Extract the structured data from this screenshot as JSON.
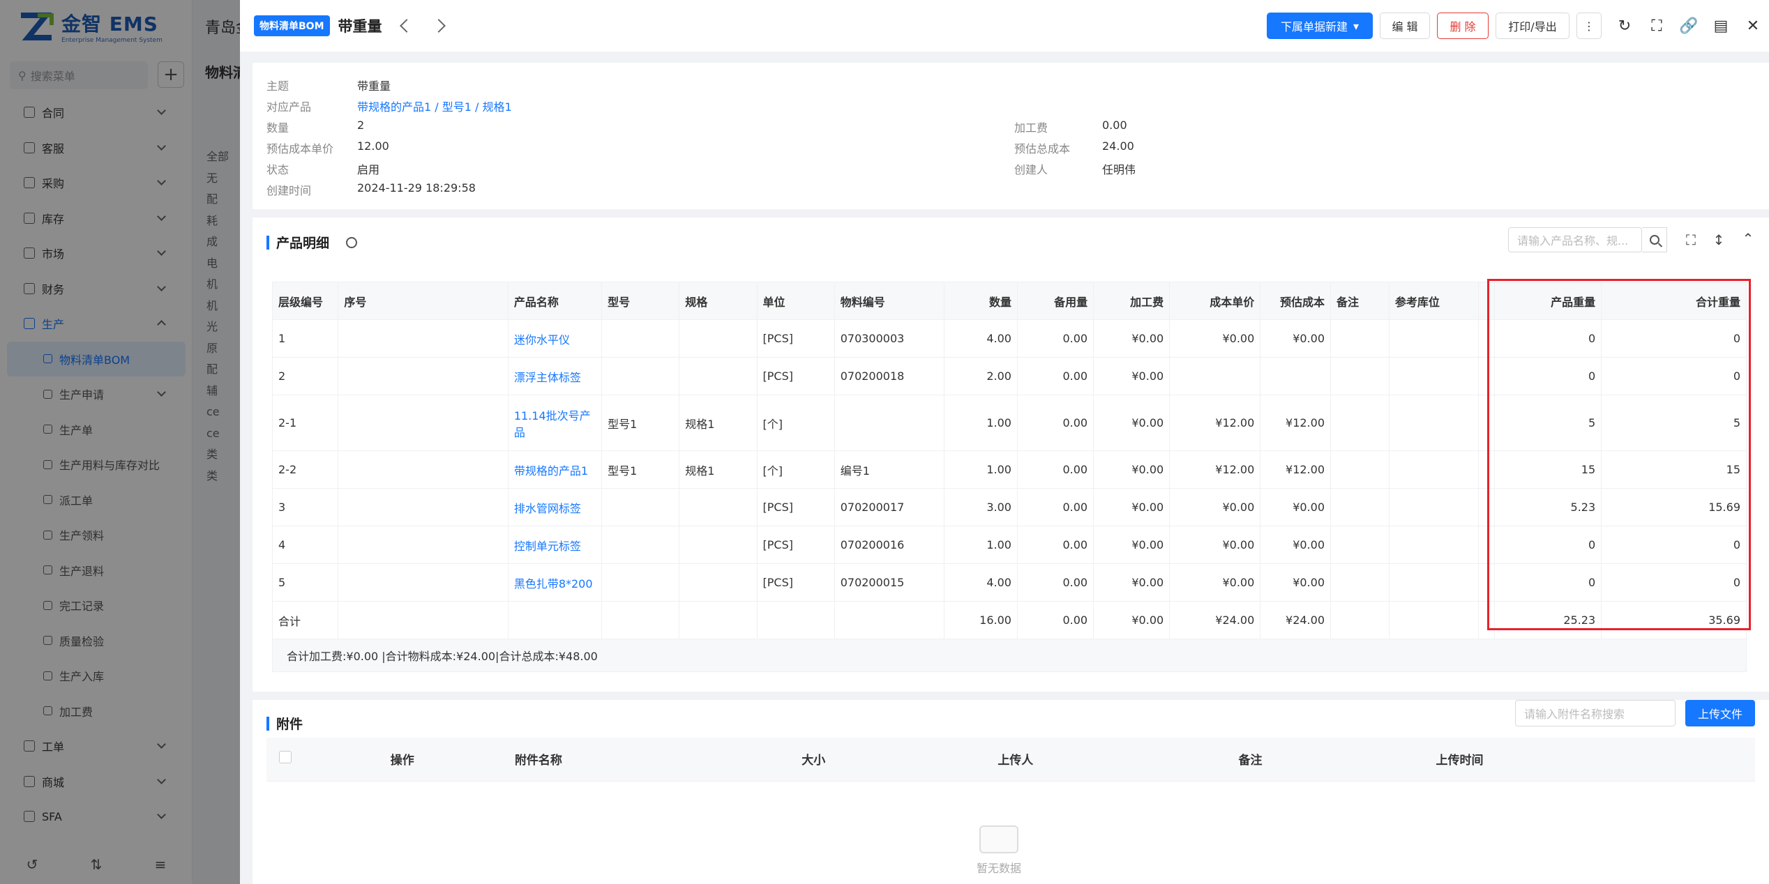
{
  "app": {
    "logo_title": "金智 EMS",
    "logo_sub": "Enterprise Management System",
    "search_placeholder": "搜索菜单",
    "bg_title": "青岛金",
    "bg_subtitle": "物料清",
    "bg_tree": [
      "全部",
      "无",
      "配",
      "耗",
      "成",
      "电",
      "机",
      "机",
      "光",
      "原",
      "配",
      "辅",
      "ce",
      "ce",
      "类",
      "类"
    ]
  },
  "sidebar": {
    "items": [
      {
        "label": "合同"
      },
      {
        "label": "客服"
      },
      {
        "label": "采购"
      },
      {
        "label": "库存"
      },
      {
        "label": "市场"
      },
      {
        "label": "财务"
      },
      {
        "label": "生产"
      }
    ],
    "sub_items": [
      {
        "label": "物料清单BOM"
      },
      {
        "label": "生产申请"
      },
      {
        "label": "生产单"
      },
      {
        "label": "生产用料与库存对比"
      },
      {
        "label": "派工单"
      },
      {
        "label": "生产领料"
      },
      {
        "label": "生产退料"
      },
      {
        "label": "完工记录"
      },
      {
        "label": "质量检验"
      },
      {
        "label": "生产入库"
      },
      {
        "label": "加工费"
      }
    ],
    "bottom_items": [
      {
        "label": "工单"
      },
      {
        "label": "商城"
      },
      {
        "label": "SFA"
      }
    ]
  },
  "drawer": {
    "tag": "物料清单BOM",
    "title": "带重量",
    "buttons": {
      "new_child": "下属单据新建",
      "edit": "编 辑",
      "delete": "删 除",
      "print": "打印/导出"
    }
  },
  "info": {
    "subject_label": "主题",
    "subject": "带重量",
    "product_label": "对应产品",
    "product": "带规格的产品1 / 型号1 / 规格1",
    "qty_label": "数量",
    "qty": "2",
    "unit_cost_label": "预估成本单价",
    "unit_cost": "12.00",
    "status_label": "状态",
    "status": "启用",
    "created_label": "创建时间",
    "created": "2024-11-29 18:29:58",
    "fee_label": "加工费",
    "fee": "0.00",
    "total_cost_label": "预估总成本",
    "total_cost": "24.00",
    "creator_label": "创建人",
    "creator": "任明伟"
  },
  "detail": {
    "title": "产品明细",
    "search_placeholder": "请输入产品名称、规...",
    "columns": [
      "层级编号",
      "序号",
      "产品名称",
      "型号",
      "规格",
      "单位",
      "物料编号",
      "数量",
      "备用量",
      "加工费",
      "成本单价",
      "预估成本",
      "备注",
      "参考库位",
      "",
      "产品重量",
      "合计重量"
    ],
    "rows": [
      [
        "1",
        "",
        "迷你水平仪",
        "",
        "",
        "[PCS]",
        "070300003",
        "4.00",
        "0.00",
        "¥0.00",
        "¥0.00",
        "¥0.00",
        "",
        "",
        "",
        "0",
        "0"
      ],
      [
        "2",
        "",
        "漂浮主体标签",
        "",
        "",
        "[PCS]",
        "070200018",
        "2.00",
        "0.00",
        "¥0.00",
        "",
        "",
        "",
        "",
        "",
        "0",
        "0"
      ],
      [
        "2-1",
        "",
        "11.14批次号产品",
        "型号1",
        "规格1",
        "[个]",
        "",
        "1.00",
        "0.00",
        "¥0.00",
        "¥12.00",
        "¥12.00",
        "",
        "",
        "",
        "5",
        "5"
      ],
      [
        "2-2",
        "",
        "带规格的产品1",
        "型号1",
        "规格1",
        "[个]",
        "编号1",
        "1.00",
        "0.00",
        "¥0.00",
        "¥12.00",
        "¥12.00",
        "",
        "",
        "",
        "15",
        "15"
      ],
      [
        "3",
        "",
        "排水管网标签",
        "",
        "",
        "[PCS]",
        "070200017",
        "3.00",
        "0.00",
        "¥0.00",
        "¥0.00",
        "¥0.00",
        "",
        "",
        "",
        "5.23",
        "15.69"
      ],
      [
        "4",
        "",
        "控制单元标签",
        "",
        "",
        "[PCS]",
        "070200016",
        "1.00",
        "0.00",
        "¥0.00",
        "¥0.00",
        "¥0.00",
        "",
        "",
        "",
        "0",
        "0"
      ],
      [
        "5",
        "",
        "黑色扎带8*200",
        "",
        "",
        "[PCS]",
        "070200015",
        "4.00",
        "0.00",
        "¥0.00",
        "¥0.00",
        "¥0.00",
        "",
        "",
        "",
        "0",
        "0"
      ]
    ],
    "total_row": [
      "合计",
      "",
      "",
      "",
      "",
      "",
      "",
      "16.00",
      "0.00",
      "¥0.00",
      "¥24.00",
      "¥24.00",
      "",
      "",
      "",
      "25.23",
      "35.69"
    ],
    "summary": "合计加工费:¥0.00 |合计物料成本:¥24.00|合计总成本:¥48.00"
  },
  "attachments": {
    "title": "附件",
    "search_placeholder": "请输入附件名称搜索",
    "upload": "上传文件",
    "columns": [
      "操作",
      "附件名称",
      "大小",
      "上传人",
      "备注",
      "上传时间"
    ],
    "empty": "暂无数据"
  }
}
